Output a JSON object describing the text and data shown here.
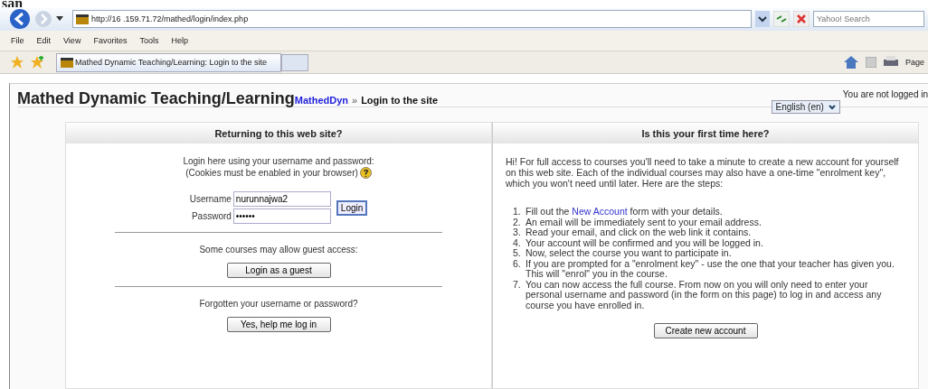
{
  "caption_fragment": "san",
  "browser": {
    "address": "http://16 .159.71.72/mathed/login/index.php",
    "search": {
      "placeholder": "Yahoo! Search"
    },
    "menu": [
      "File",
      "Edit",
      "View",
      "Favorites",
      "Tools",
      "Help"
    ],
    "tab": {
      "title": "Mathed Dynamic Teaching/Learning: Login to the site",
      "selected": true
    },
    "toolbar_page": "Page"
  },
  "page": {
    "site_title": "Mathed Dynamic Teaching/Learning",
    "breadcrumb": {
      "link": "MathedDyn",
      "separator": "»",
      "current": "Login to the site"
    },
    "language": "English (en)",
    "login_status": "You are not logged in",
    "returning": {
      "heading": "Returning to this web site?",
      "intro": [
        "Login here using your username and password:",
        "(Cookies must be enabled in your browser)"
      ],
      "username_label": "Username",
      "username": "nurunnajwa2",
      "password_label": "Password",
      "password": "••••••",
      "login_button": "Login",
      "guest_text": "Some courses may allow guest access:",
      "guest_button": "Login as a guest",
      "forgot_text": "Forgotten your username or password?",
      "forgot_button": "Yes, help me log in"
    },
    "first_time": {
      "heading": "Is this your first time here?",
      "intro": "Hi! For full access to courses you'll need to take a minute to create a new account for yourself on this web site. Each of the individual courses may also have a one-time \"enrolment key\", which you won't need until later. Here are the steps:",
      "steps": [
        {
          "number": "1.",
          "text": "Fill out the ",
          "link": "New Account",
          "after": " form with your details."
        },
        {
          "number": "2.",
          "text": "An email will be immediately sent to your email address."
        },
        {
          "number": "3.",
          "text": "Read your email, and click on the web link it contains."
        },
        {
          "number": "4.",
          "text": "Your account will be confirmed and you will be logged in."
        },
        {
          "number": "5.",
          "text": "Now, select the course you want to participate in."
        },
        {
          "number": "6.",
          "text": "If you are prompted for a \"enrolment key\" - use the one that your teacher has given you. This will \"enrol\" you in the course."
        },
        {
          "number": "7.",
          "text": "You can now access the full course. From now on you will only need to enter your personal username and password (in the form on this page) to log in and access any course you have enrolled in."
        }
      ],
      "create_button": "Create new account"
    }
  }
}
